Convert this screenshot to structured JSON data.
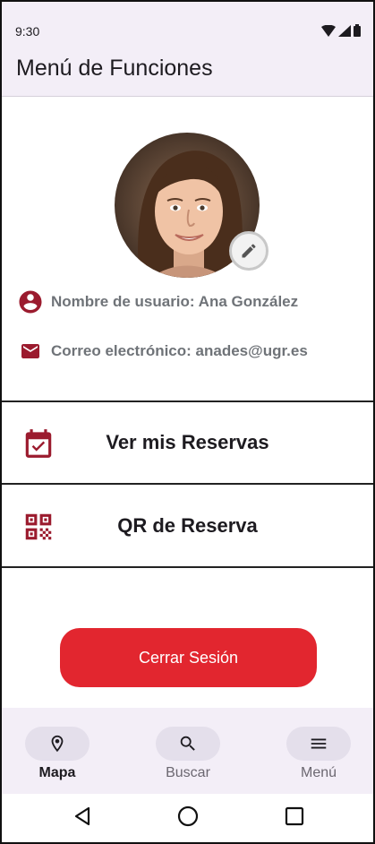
{
  "status": {
    "time": "9:30"
  },
  "header": {
    "title": "Menú de Funciones"
  },
  "profile": {
    "username_text": "Nombre de usuario: Ana González",
    "email_text": "Correo electrónico: anades@ugr.es"
  },
  "menu": {
    "reservations_label": "Ver mis Reservas",
    "qr_label": "QR de Reserva"
  },
  "logout_label": "Cerrar Sesión",
  "bottom_nav": {
    "items": [
      {
        "label": "Mapa",
        "icon": "map-pin-icon",
        "active": true
      },
      {
        "label": "Buscar",
        "icon": "search-icon",
        "active": false
      },
      {
        "label": "Menú",
        "icon": "hamburger-menu-icon",
        "active": false
      }
    ]
  },
  "colors": {
    "accent": "#e2262f",
    "icon_red": "#9b1b2e",
    "bar_bg": "#f3eef7"
  }
}
